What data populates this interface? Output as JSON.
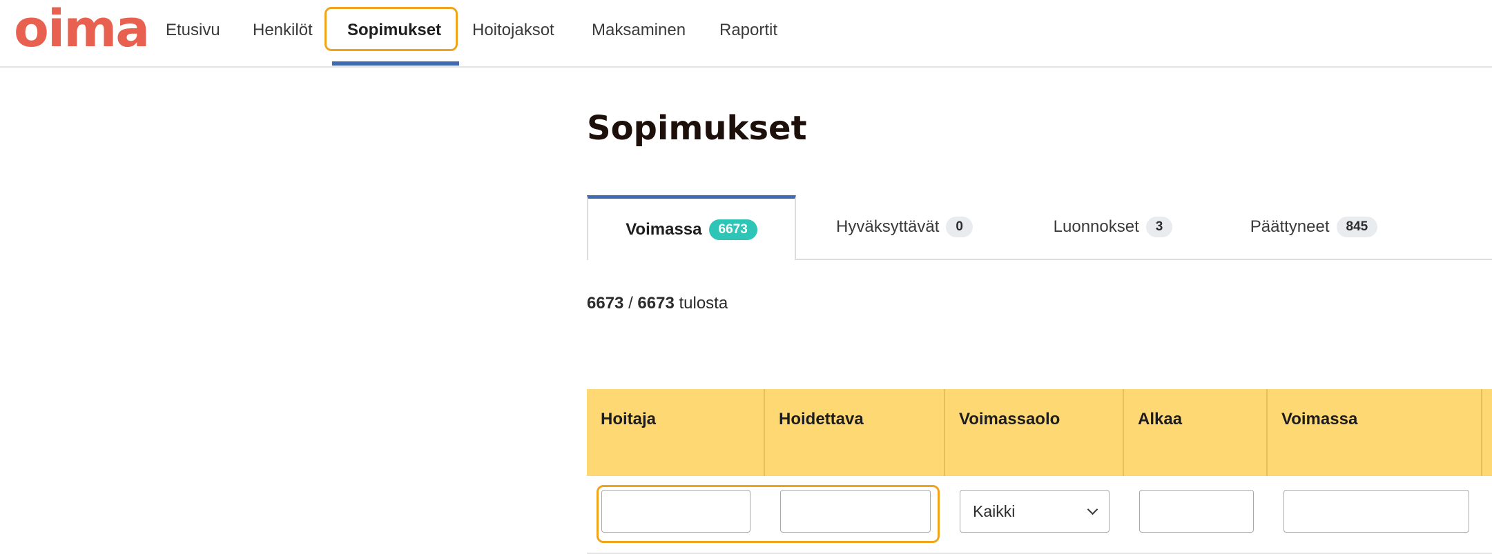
{
  "brand": {
    "logo_text": "oima",
    "logo_color": "#e8604f"
  },
  "nav": {
    "items": [
      {
        "label": "Etusivu",
        "active": false
      },
      {
        "label": "Henkilöt",
        "active": false
      },
      {
        "label": "Sopimukset",
        "active": true
      },
      {
        "label": "Hoitojaksot",
        "active": false
      },
      {
        "label": "Maksaminen",
        "active": false
      },
      {
        "label": "Raportit",
        "active": false
      }
    ]
  },
  "page": {
    "title": "Sopimukset"
  },
  "tabs": [
    {
      "label": "Voimassa",
      "count": "6673",
      "active": true
    },
    {
      "label": "Hyväksyttävät",
      "count": "0",
      "active": false
    },
    {
      "label": "Luonnokset",
      "count": "3",
      "active": false
    },
    {
      "label": "Päättyneet",
      "count": "845",
      "active": false
    }
  ],
  "results": {
    "shown": "6673",
    "separator": "/",
    "total": "6673",
    "suffix": "tulosta"
  },
  "table": {
    "columns": [
      "Hoitaja",
      "Hoidettava",
      "Voimassaolo",
      "Alkaa",
      "Voimassa"
    ],
    "filters": {
      "hoitaja": "",
      "hoidettava": "",
      "voimassaolo_selected": "Kaikki",
      "alkaa": "",
      "voimassa": ""
    }
  },
  "colors": {
    "accent_blue": "#3f6ab3",
    "focus_orange": "#f0a41c",
    "header_yellow": "#fed873",
    "badge_teal": "#2ec4b6"
  }
}
